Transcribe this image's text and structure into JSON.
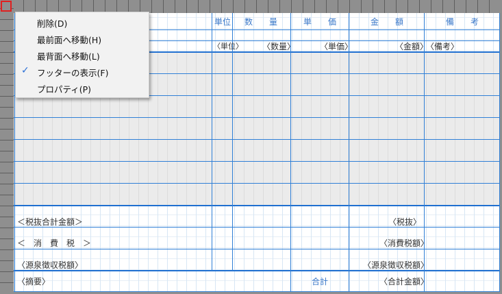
{
  "context_menu": {
    "items": [
      {
        "label": "削除(D)",
        "checked": false
      },
      {
        "label": "最前面へ移動(H)",
        "checked": false
      },
      {
        "label": "最背面へ移動(L)",
        "checked": false
      },
      {
        "label": "フッターの表示(F)",
        "checked": true
      },
      {
        "label": "プロパティ(P)",
        "checked": false
      }
    ],
    "check_glyph": "✓"
  },
  "table_header": {
    "unit": "単位",
    "quantity": "数　　量",
    "unit_price": "単　　価",
    "amount": "金　　額",
    "remarks": "備　　考"
  },
  "field_row": {
    "unit": "〈単位〉",
    "quantity": "〈数量〉",
    "unit_price": "〈単価〉",
    "amount": "〈金額〉",
    "remarks": "〈備考〉"
  },
  "footer": {
    "subtotal_label": "＜税抜合計金額＞",
    "subtotal_field": "〈税抜〉",
    "tax_label": "＜　消　費　税　＞",
    "tax_field": "〈消費税額〉",
    "withholding_label": "〈源泉徴収税額〉",
    "withholding_field": "〈源泉徴収税額〉",
    "summary_field": "〈摘要〉",
    "total_label": "合計",
    "total_field": "〈合計金額〉"
  },
  "colors": {
    "frame": "#8f8f8f",
    "grid_line": "#2f7fd6",
    "header_text": "#3a78c9",
    "selection_handle": "#e02020",
    "detail_band": "#ebebeb"
  }
}
